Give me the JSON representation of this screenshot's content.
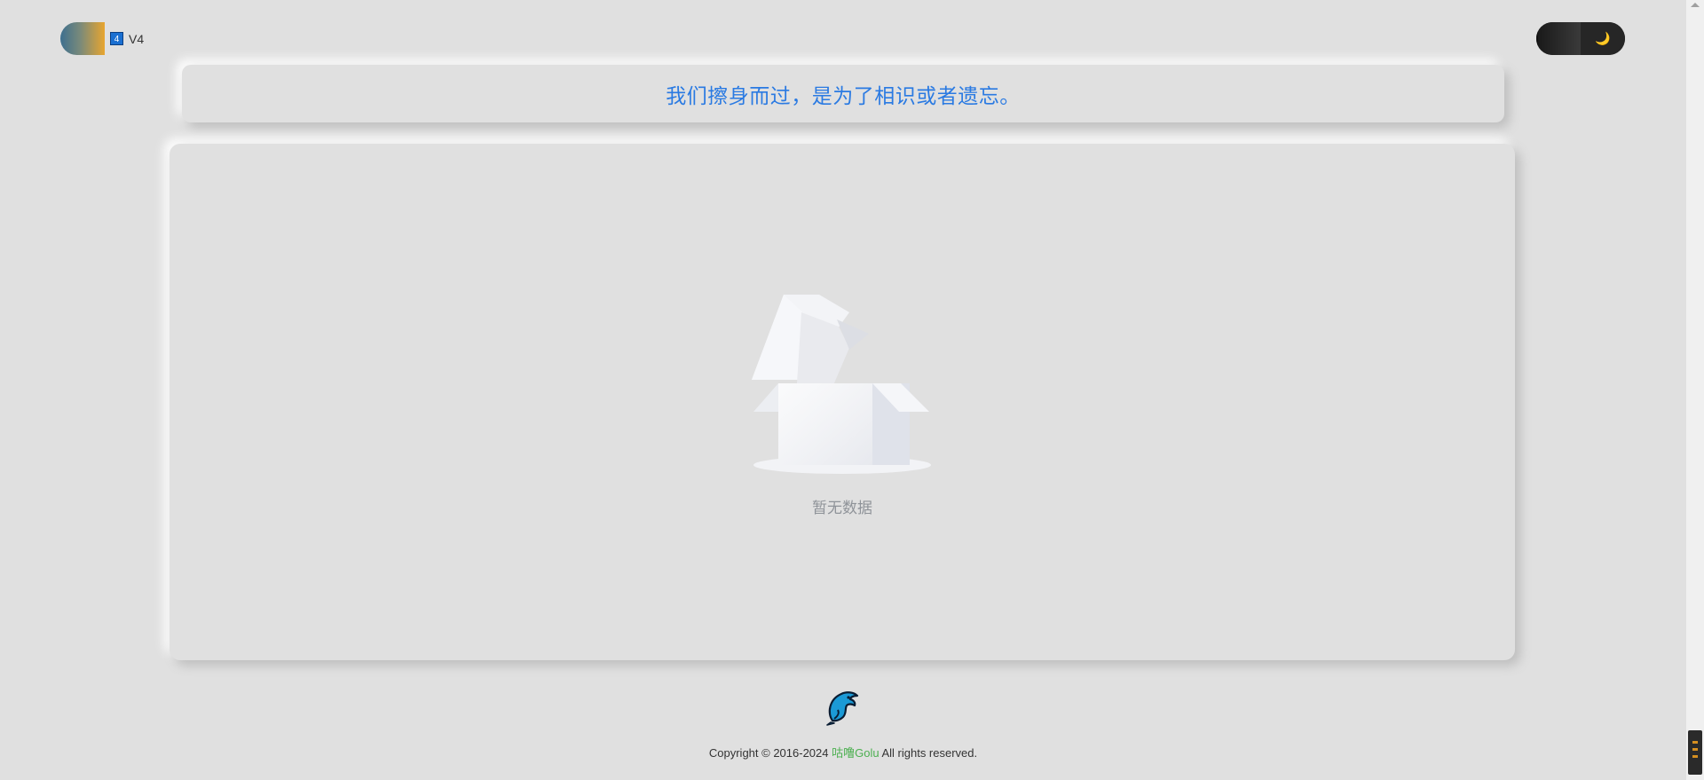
{
  "header": {
    "version_badge": "4",
    "version_label": "V4",
    "theme_toggle_icon": "🌙"
  },
  "quote": {
    "text": "我们擦身而过，是为了相识或者遗忘。"
  },
  "main": {
    "empty_text": "暂无数据"
  },
  "footer": {
    "copyright_prefix": "Copyright © 2016-2024 ",
    "brand": "咕噜Golu",
    "copyright_suffix": " All rights reserved."
  },
  "colors": {
    "background": "#e0e0e0",
    "quote_text": "#2a7ae2",
    "brand": "#4caf50",
    "empty_text": "#8f9399"
  }
}
